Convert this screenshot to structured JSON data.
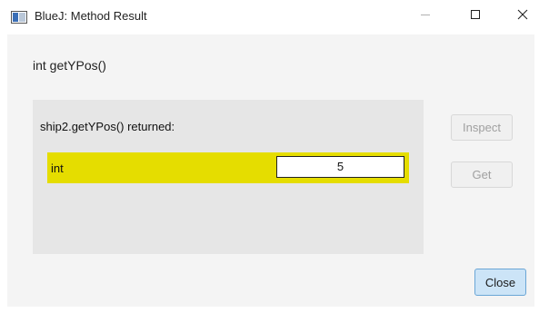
{
  "window": {
    "title": "BlueJ:  Method Result",
    "icon": "bluej-app-icon",
    "controls": {
      "minimize_icon": "minimize-icon",
      "maximize_icon": "maximize-icon",
      "close_icon": "close-icon"
    }
  },
  "dialog": {
    "method_signature": "int getYPos()",
    "result": {
      "returned_text": "ship2.getYPos() returned:",
      "type": "int",
      "value": "5"
    },
    "buttons": {
      "inspect": "Inspect",
      "get": "Get",
      "close": "Close"
    }
  },
  "colors": {
    "result_highlight": "#e5dd00",
    "close_button_bg": "#cce4f7",
    "close_button_border": "#6aa6d6",
    "disabled_text": "#a0a0a0"
  }
}
